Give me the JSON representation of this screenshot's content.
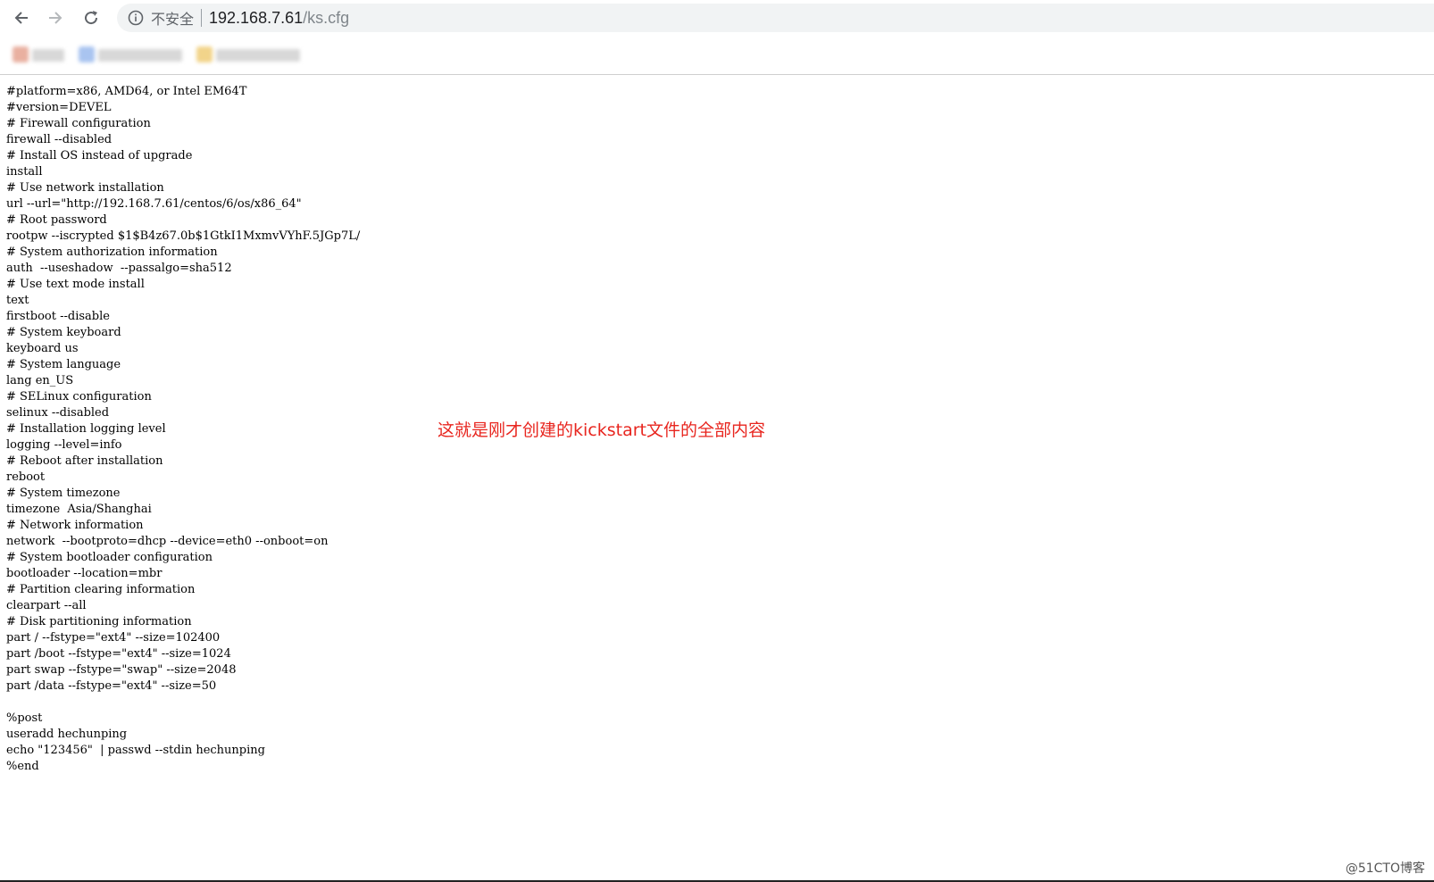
{
  "browser": {
    "security_label": "不安全",
    "url_host": "192.168.7.61",
    "url_path": "/ks.cfg"
  },
  "icons": {
    "back": "arrow-left-icon",
    "forward": "arrow-right-icon",
    "reload": "reload-icon",
    "info": "info-circle-icon"
  },
  "bookmarks": [
    {
      "favicon_color": "#e9b0a0"
    },
    {
      "favicon_color": "#a9c4f0"
    },
    {
      "favicon_color": "#f2d48a"
    }
  ],
  "file_lines": [
    "#platform=x86, AMD64, or Intel EM64T",
    "#version=DEVEL",
    "# Firewall configuration",
    "firewall --disabled",
    "# Install OS instead of upgrade",
    "install",
    "# Use network installation",
    "url --url=\"http://192.168.7.61/centos/6/os/x86_64\"",
    "# Root password",
    "rootpw --iscrypted $1$B4z67.0b$1GtkI1MxmvVYhF.5JGp7L/",
    "# System authorization information",
    "auth  --useshadow  --passalgo=sha512",
    "# Use text mode install",
    "text",
    "firstboot --disable",
    "# System keyboard",
    "keyboard us",
    "# System language",
    "lang en_US",
    "# SELinux configuration",
    "selinux --disabled",
    "# Installation logging level",
    "logging --level=info",
    "# Reboot after installation",
    "reboot",
    "# System timezone",
    "timezone  Asia/Shanghai",
    "# Network information",
    "network  --bootproto=dhcp --device=eth0 --onboot=on",
    "# System bootloader configuration",
    "bootloader --location=mbr",
    "# Partition clearing information",
    "clearpart --all",
    "# Disk partitioning information",
    "part / --fstype=\"ext4\" --size=102400",
    "part /boot --fstype=\"ext4\" --size=1024",
    "part swap --fstype=\"swap\" --size=2048",
    "part /data --fstype=\"ext4\" --size=50",
    "",
    "%post",
    "useradd hechunping",
    "echo \"123456\"  | passwd --stdin hechunping",
    "%end"
  ],
  "annotation": "这就是刚才创建的kickstart文件的全部内容",
  "watermark": "@51CTO博客",
  "colors": {
    "annotation": "#e8261f",
    "omnibox_bg": "#f1f3f4"
  }
}
